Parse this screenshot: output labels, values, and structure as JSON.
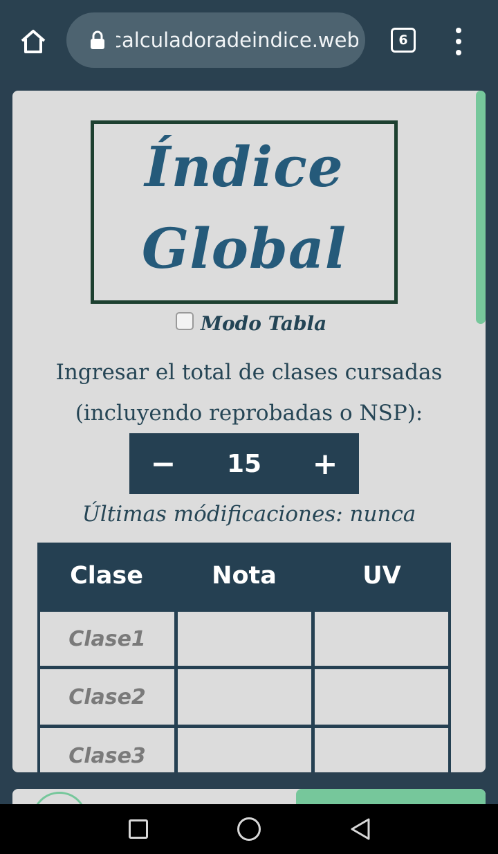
{
  "browser": {
    "url": "calculadoradeindice.web",
    "tab_count": "6"
  },
  "app": {
    "logo_line1": "Índice",
    "logo_line2": "Global",
    "mode_label": "Modo Tabla",
    "mode_checked": false,
    "instruction_line1": "Ingresar el total de clases cursadas",
    "instruction_line2": "(incluyendo reprobadas o NSP):",
    "stepper": {
      "minus": "−",
      "value": "15",
      "plus": "+"
    },
    "last_modified": "Últimas módificaciones: nunca"
  },
  "table": {
    "headers": [
      "Clase",
      "Nota",
      "UV"
    ],
    "rows": [
      {
        "clase": "Clase1",
        "nota": "",
        "uv": ""
      },
      {
        "clase": "Clase2",
        "nota": "",
        "uv": ""
      },
      {
        "clase": "Clase3",
        "nota": "",
        "uv": ""
      }
    ]
  },
  "colors": {
    "header_bg": "#2a4150",
    "dark_blue": "#254052",
    "logo_text": "#255a7a",
    "accent_green": "#76c79b",
    "card_bg": "#dcdcdc"
  },
  "icons": {
    "home": "home-icon",
    "lock": "lock-icon",
    "menu": "more-vert-icon",
    "nav_recents": "square-icon",
    "nav_home": "circle-icon",
    "nav_back": "triangle-back-icon"
  }
}
